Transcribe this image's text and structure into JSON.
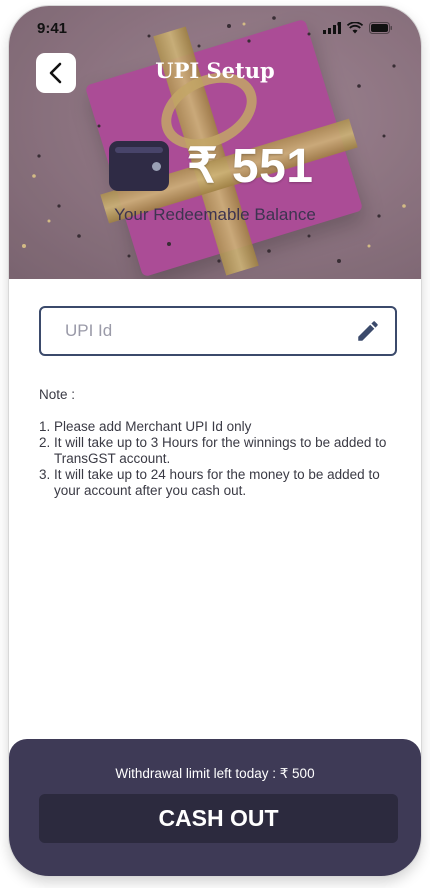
{
  "status_bar": {
    "time": "9:41"
  },
  "header": {
    "title": "UPI Setup",
    "back_icon": "chevron-left-icon"
  },
  "balance": {
    "currency_symbol": "₹",
    "amount": "551",
    "label": "Your Redeemable Balance",
    "wallet_icon": "wallet-icon"
  },
  "upi_input": {
    "placeholder": "UPI Id",
    "value": "",
    "edit_icon": "pencil-icon"
  },
  "note": {
    "heading": "Note :",
    "items": [
      "Please add Merchant UPI Id only",
      "It will take up to 3 Hours for the winnings to be added to TransGST account.",
      "It will take up to 24 hours for the money to be added to your account after you cash out."
    ]
  },
  "footer": {
    "limit_text": "Withdrawal limit left today : ₹ 500",
    "cashout_label": "CASH OUT"
  },
  "colors": {
    "bottom_sheet": "#3e3a56",
    "button": "#2c2a3e",
    "input_border": "#3b4a6b",
    "wallet": "#2f2b45"
  }
}
